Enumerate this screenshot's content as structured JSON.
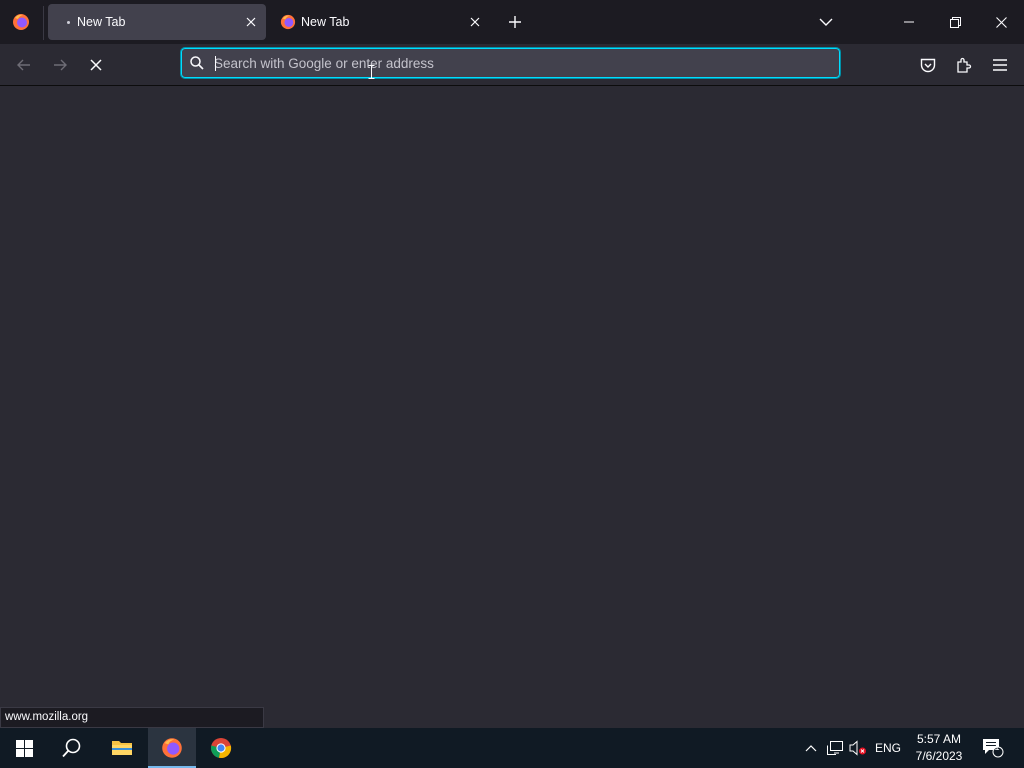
{
  "browser": {
    "tabs": [
      {
        "label": "New Tab",
        "active": true
      },
      {
        "label": "New Tab",
        "active": false
      }
    ],
    "urlbar": {
      "placeholder": "Search with Google or enter address",
      "value": ""
    },
    "status_text": "www.mozilla.org"
  },
  "taskbar": {
    "apps": [
      "start",
      "search",
      "file-explorer",
      "firefox",
      "chrome"
    ],
    "language": "ENG",
    "time": "5:57 AM",
    "date": "7/6/2023",
    "notification_count": "1"
  },
  "colors": {
    "accent": "#00ddff",
    "taskbar": "#101a24",
    "content": "#2b2a33"
  }
}
